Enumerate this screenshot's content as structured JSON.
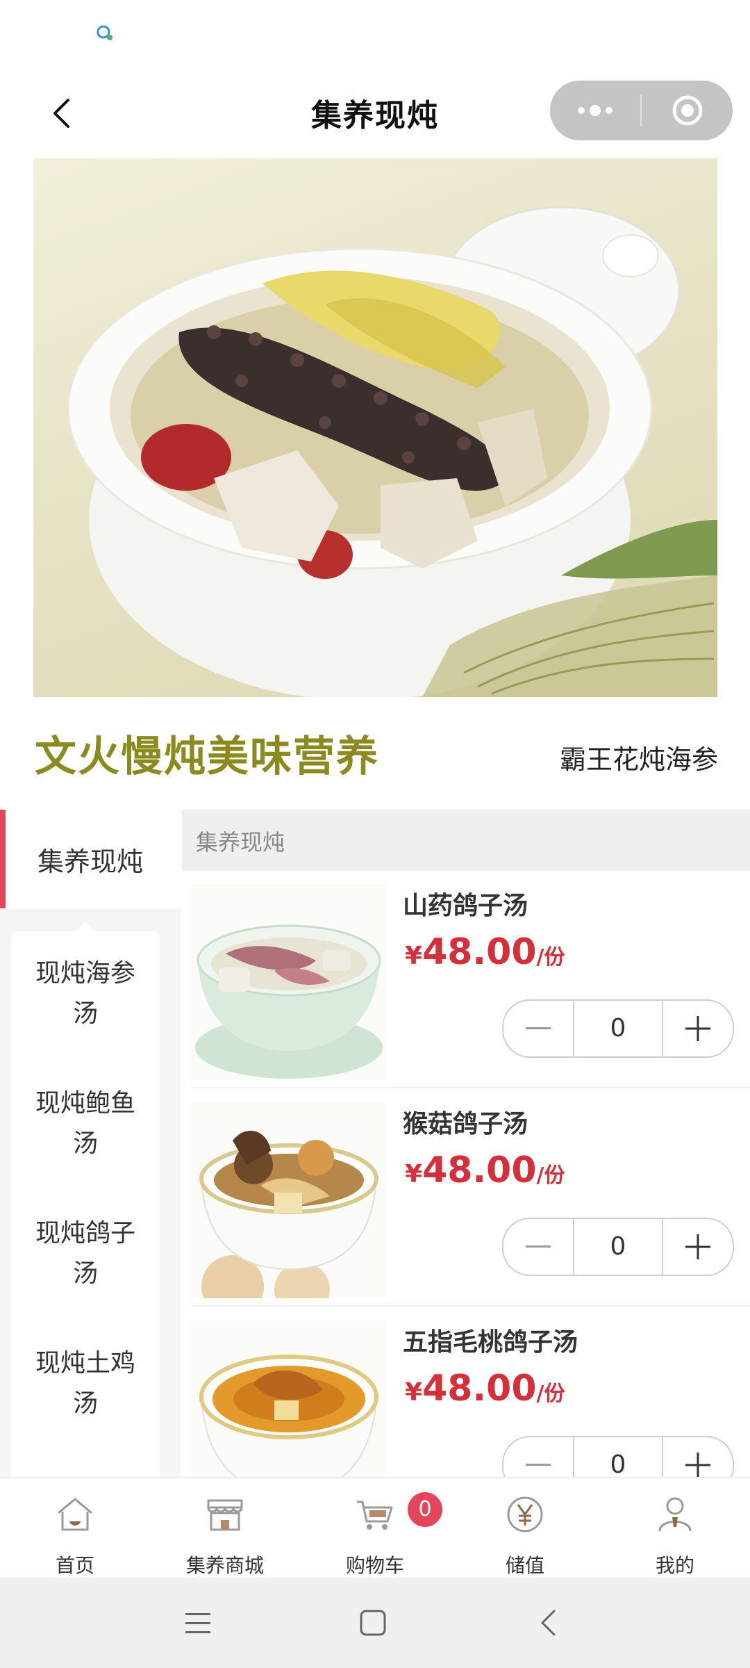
{
  "header": {
    "title": "集养现炖"
  },
  "hero": {
    "slogan": "文火慢炖美味营养",
    "dish_name": "霸王花炖海参"
  },
  "sidebar": {
    "active_category": "集养现炖",
    "items": [
      {
        "line1": "现炖海参",
        "line2": "汤"
      },
      {
        "line1": "现炖鲍鱼",
        "line2": "汤"
      },
      {
        "line1": "现炖鸽子",
        "line2": "汤"
      },
      {
        "line1": "现炖土鸡",
        "line2": "汤"
      }
    ]
  },
  "list": {
    "category_title": "集养现炖",
    "products": [
      {
        "name": "山药鸽子汤",
        "currency": "¥",
        "price": "48.00",
        "unit": "/份",
        "quantity": "0"
      },
      {
        "name": "猴菇鸽子汤",
        "currency": "¥",
        "price": "48.00",
        "unit": "/份",
        "quantity": "0"
      },
      {
        "name": "五指毛桃鸽子汤",
        "currency": "¥",
        "price": "48.00",
        "unit": "/份",
        "quantity": "0"
      }
    ]
  },
  "tabbar": {
    "tabs": [
      {
        "label": "首页",
        "icon": "home-icon"
      },
      {
        "label": "集养商城",
        "icon": "shop-icon"
      },
      {
        "label": "购物车",
        "icon": "cart-icon"
      },
      {
        "label": "储值",
        "icon": "yen-icon"
      },
      {
        "label": "我的",
        "icon": "user-icon"
      }
    ],
    "cart_badge": "0"
  },
  "colors": {
    "accent_red": "#e5455a",
    "price_red": "#d62f3c",
    "slogan_olive": "#8a8a1f"
  }
}
